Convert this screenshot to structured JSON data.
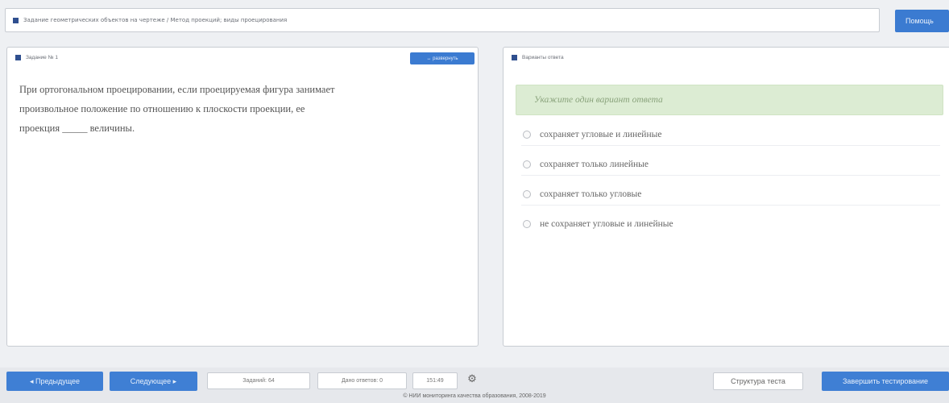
{
  "topic": {
    "text": "Задание геометрических объектов на чертеже / Метод проекций; виды проецирования"
  },
  "help_button": {
    "label": "Помощь"
  },
  "question": {
    "header": "Задание № 1",
    "expand_label": "↔ развернуть",
    "lines": [
      "При ортогональном проецировании, если проецируемая фигура занимает",
      "произвольное положение по отношению к плоскости проекции, ее",
      "проекция _____ величины."
    ]
  },
  "answers": {
    "header": "Варианты ответа",
    "hint": "Укажите один вариант ответа",
    "options": [
      "сохраняет угловые и линейные",
      "сохраняет только линейные",
      "сохраняет только угловые",
      "не сохраняет угловые и линейные"
    ]
  },
  "bottom": {
    "prev_label": "◂ Предыдущее",
    "next_label": "Следующее ▸",
    "tasks_label": "Заданий: 64",
    "answered_label": "Дано ответов: 0",
    "timer": "151:49",
    "settings_icon": "gear-icon",
    "structure_label": "Структура теста",
    "finish_label": "Завершить тестирование"
  },
  "footer": {
    "text": "© НИИ мониторинга качества образования, 2008-2019"
  },
  "colors": {
    "accent": "#3b7bd1",
    "hint_bg": "#dcecd3",
    "background": "#eef0f3"
  }
}
